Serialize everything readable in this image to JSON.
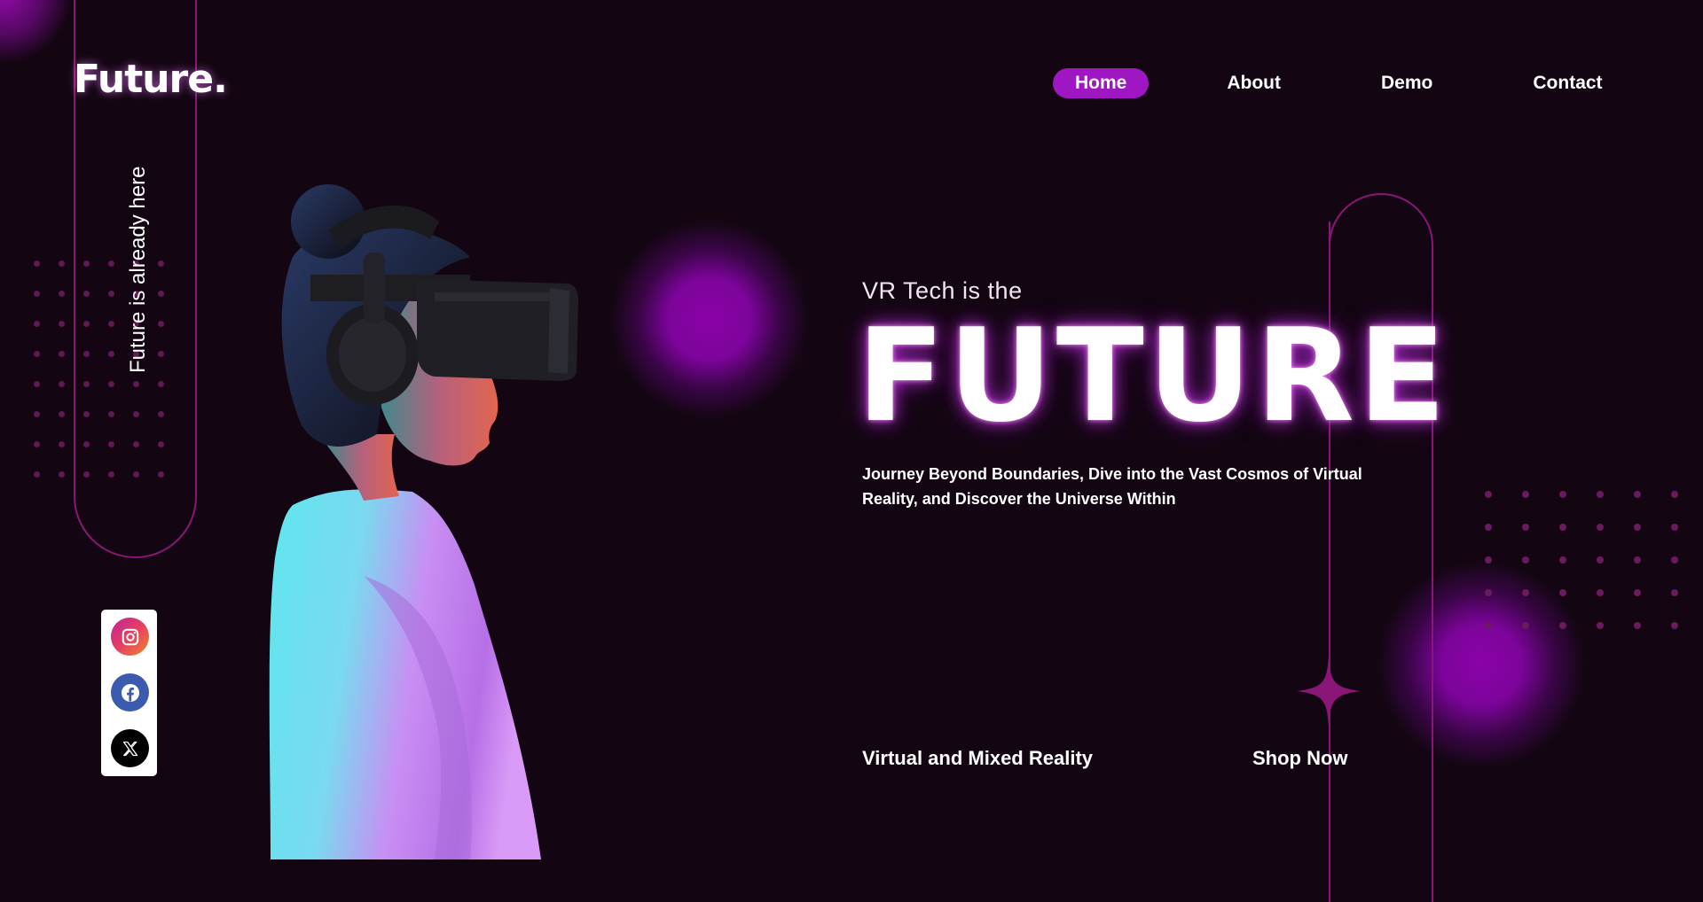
{
  "brand": {
    "logo": "Future."
  },
  "nav": {
    "items": [
      {
        "label": "Home",
        "active": true
      },
      {
        "label": "About"
      },
      {
        "label": "Demo"
      },
      {
        "label": "Contact"
      }
    ]
  },
  "sidebar": {
    "tagline": "Future is already here"
  },
  "social": [
    {
      "icon": "instagram-icon"
    },
    {
      "icon": "facebook-icon"
    },
    {
      "icon": "x-twitter-icon"
    }
  ],
  "hero": {
    "pre_title": "VR Tech is the",
    "title": "FUTURE",
    "description": "Journey Beyond Boundaries, Dive into the Vast Cosmos of Virtual Reality, and Discover the Universe Within",
    "bottom_label": "Virtual and Mixed Reality",
    "cta": "Shop Now"
  },
  "colors": {
    "background": "#130612",
    "accent": "#9f16c3",
    "glow": "#8a02a9",
    "outline": "#8a1677"
  }
}
